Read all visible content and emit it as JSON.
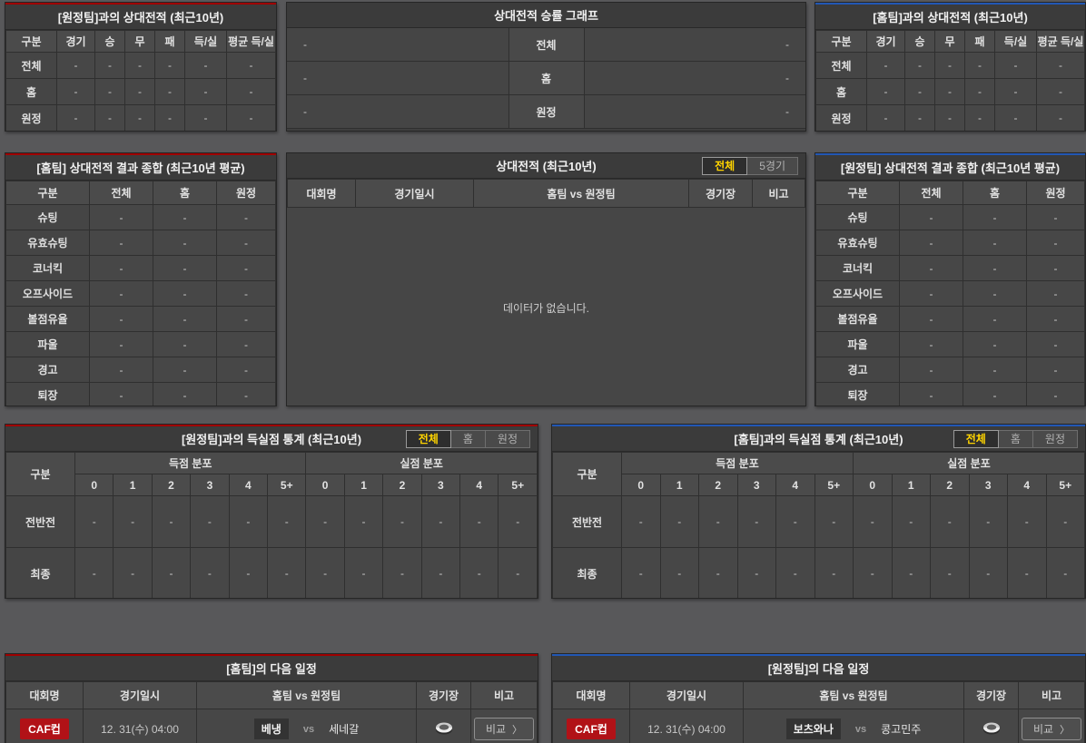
{
  "colors": {
    "page_bg": "#58585a",
    "panel_bg": "#3f3f3f",
    "home_accent_red": "#a00000",
    "away_accent_blue": "#2257b4",
    "active_tab_text": "#ffd400",
    "competition_badge_bg": "#b11217"
  },
  "h2h_vs_away": {
    "title": "[원정팀]과의 상대전적 (최근10년)",
    "columns": [
      "구분",
      "경기",
      "승",
      "무",
      "패",
      "득/실",
      "평균 득/실"
    ],
    "rows": [
      {
        "label": "전체",
        "values": [
          "-",
          "-",
          "-",
          "-",
          "-",
          "-"
        ]
      },
      {
        "label": "홈",
        "values": [
          "-",
          "-",
          "-",
          "-",
          "-",
          "-"
        ]
      },
      {
        "label": "원정",
        "values": [
          "-",
          "-",
          "-",
          "-",
          "-",
          "-"
        ]
      }
    ]
  },
  "winrate_graph": {
    "title": "상대전적 승률 그래프",
    "rows": [
      {
        "left": "-",
        "label": "전체",
        "right": "-"
      },
      {
        "left": "-",
        "label": "홈",
        "right": "-"
      },
      {
        "left": "-",
        "label": "원정",
        "right": "-"
      }
    ]
  },
  "h2h_vs_home": {
    "title": "[홈팀]과의 상대전적 (최근10년)",
    "columns": [
      "구분",
      "경기",
      "승",
      "무",
      "패",
      "득/실",
      "평균 득/실"
    ],
    "rows": [
      {
        "label": "전체",
        "values": [
          "-",
          "-",
          "-",
          "-",
          "-",
          "-"
        ]
      },
      {
        "label": "홈",
        "values": [
          "-",
          "-",
          "-",
          "-",
          "-",
          "-"
        ]
      },
      {
        "label": "원정",
        "values": [
          "-",
          "-",
          "-",
          "-",
          "-",
          "-"
        ]
      }
    ]
  },
  "summary_home": {
    "title": "[홈팀] 상대전적 결과 종합 (최근10년 평균)",
    "columns": [
      "구분",
      "전체",
      "홈",
      "원정"
    ],
    "rows": [
      {
        "label": "슈팅",
        "values": [
          "-",
          "-",
          "-"
        ]
      },
      {
        "label": "유효슈팅",
        "values": [
          "-",
          "-",
          "-"
        ]
      },
      {
        "label": "코너킥",
        "values": [
          "-",
          "-",
          "-"
        ]
      },
      {
        "label": "오프사이드",
        "values": [
          "-",
          "-",
          "-"
        ]
      },
      {
        "label": "볼점유율",
        "values": [
          "-",
          "-",
          "-"
        ]
      },
      {
        "label": "파울",
        "values": [
          "-",
          "-",
          "-"
        ]
      },
      {
        "label": "경고",
        "values": [
          "-",
          "-",
          "-"
        ]
      },
      {
        "label": "퇴장",
        "values": [
          "-",
          "-",
          "-"
        ]
      }
    ]
  },
  "h2h_matches": {
    "title": "상대전적 (최근10년)",
    "tabs": [
      {
        "label": "전체",
        "active": true
      },
      {
        "label": "5경기",
        "active": false
      }
    ],
    "columns": [
      "대회명",
      "경기일시",
      "홈팀  vs  원정팀",
      "경기장",
      "비고"
    ],
    "empty_message": "데이터가 없습니다."
  },
  "summary_away": {
    "title": "[원정팀] 상대전적 결과 종합 (최근10년 평균)",
    "columns": [
      "구분",
      "전체",
      "홈",
      "원정"
    ],
    "rows": [
      {
        "label": "슈팅",
        "values": [
          "-",
          "-",
          "-"
        ]
      },
      {
        "label": "유효슈팅",
        "values": [
          "-",
          "-",
          "-"
        ]
      },
      {
        "label": "코너킥",
        "values": [
          "-",
          "-",
          "-"
        ]
      },
      {
        "label": "오프사이드",
        "values": [
          "-",
          "-",
          "-"
        ]
      },
      {
        "label": "볼점유율",
        "values": [
          "-",
          "-",
          "-"
        ]
      },
      {
        "label": "파울",
        "values": [
          "-",
          "-",
          "-"
        ]
      },
      {
        "label": "경고",
        "values": [
          "-",
          "-",
          "-"
        ]
      },
      {
        "label": "퇴장",
        "values": [
          "-",
          "-",
          "-"
        ]
      }
    ]
  },
  "goal_stats_vs_away": {
    "title": "[원정팀]과의 득실점 통계 (최근10년)",
    "tabs": [
      {
        "label": "전체",
        "active": true
      },
      {
        "label": "홈",
        "active": false
      },
      {
        "label": "원정",
        "active": false
      }
    ],
    "corner_header": "구분",
    "groups": [
      "득점 분포",
      "실점 분포"
    ],
    "bins": [
      "0",
      "1",
      "2",
      "3",
      "4",
      "5+"
    ],
    "rows": [
      {
        "label": "전반전",
        "values": [
          "-",
          "-",
          "-",
          "-",
          "-",
          "-",
          "-",
          "-",
          "-",
          "-",
          "-",
          "-"
        ]
      },
      {
        "label": "최종",
        "values": [
          "-",
          "-",
          "-",
          "-",
          "-",
          "-",
          "-",
          "-",
          "-",
          "-",
          "-",
          "-"
        ]
      }
    ]
  },
  "goal_stats_vs_home": {
    "title": "[홈팀]과의 득실점 통계 (최근10년)",
    "tabs": [
      {
        "label": "전체",
        "active": true
      },
      {
        "label": "홈",
        "active": false
      },
      {
        "label": "원정",
        "active": false
      }
    ],
    "corner_header": "구분",
    "groups": [
      "득점 분포",
      "실점 분포"
    ],
    "bins": [
      "0",
      "1",
      "2",
      "3",
      "4",
      "5+"
    ],
    "rows": [
      {
        "label": "전반전",
        "values": [
          "-",
          "-",
          "-",
          "-",
          "-",
          "-",
          "-",
          "-",
          "-",
          "-",
          "-",
          "-"
        ]
      },
      {
        "label": "최종",
        "values": [
          "-",
          "-",
          "-",
          "-",
          "-",
          "-",
          "-",
          "-",
          "-",
          "-",
          "-",
          "-"
        ]
      }
    ]
  },
  "schedule_home": {
    "title": "[홈팀]의 다음 일정",
    "columns": [
      "대회명",
      "경기일시",
      "홈팀  vs  원정팀",
      "경기장",
      "비고"
    ],
    "match": {
      "competition": "CAF컵",
      "datetime": "12. 31(수) 04:00",
      "home_team": "베냉",
      "vs_label": "vs",
      "away_team": "세네갈",
      "venue_icon": "stadium-icon",
      "compare_label": "비교",
      "compare_chevron": "〉"
    }
  },
  "schedule_away": {
    "title": "[원정팀]의 다음 일정",
    "columns": [
      "대회명",
      "경기일시",
      "홈팀  vs  원정팀",
      "경기장",
      "비고"
    ],
    "match": {
      "competition": "CAF컵",
      "datetime": "12. 31(수) 04:00",
      "home_team": "보츠와나",
      "vs_label": "vs",
      "away_team": "콩고민주",
      "venue_icon": "stadium-icon",
      "compare_label": "비교",
      "compare_chevron": "〉"
    }
  }
}
